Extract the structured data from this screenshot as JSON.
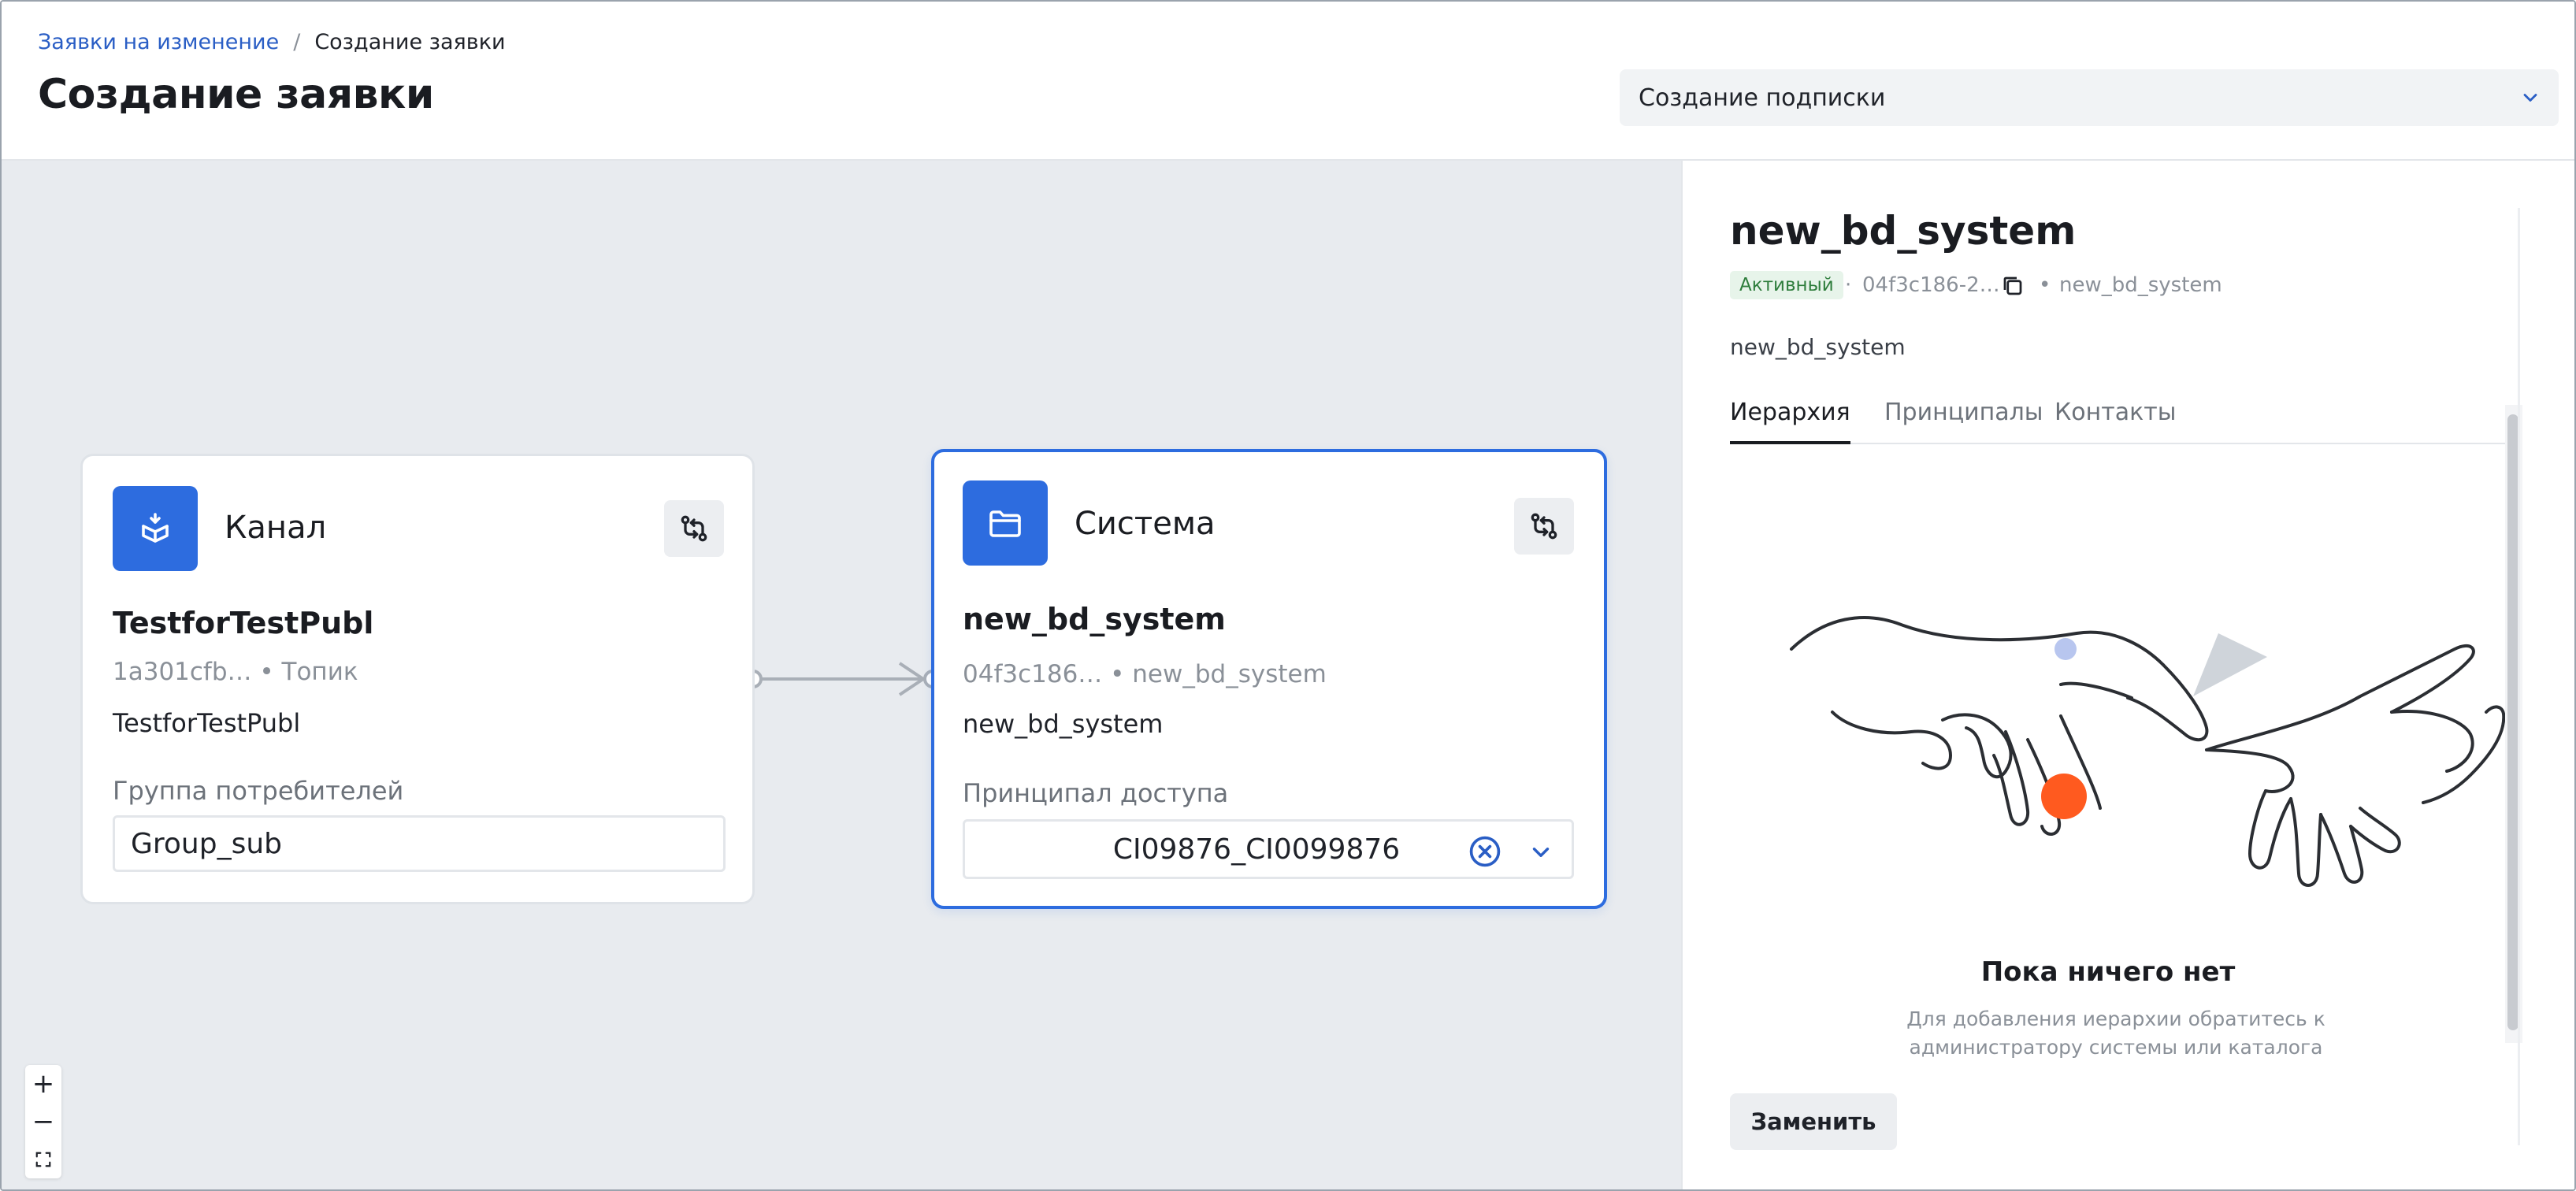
{
  "breadcrumb": {
    "parent": "Заявки на изменение",
    "separator": "/",
    "current": "Создание заявки"
  },
  "page_title": "Создание заявки",
  "request_type_select": {
    "value": "Создание подписки"
  },
  "canvas": {
    "source_node": {
      "type_label": "Канал",
      "name": "TestforTestPubl",
      "meta": "1a301cfb… • Топик",
      "description": "TestforTestPubl",
      "field_label": "Группа потребителей",
      "field_value": "Group_sub"
    },
    "target_node": {
      "type_label": "Система",
      "name": "new_bd_system",
      "meta": "04f3c186… • new_bd_system",
      "description": "new_bd_system",
      "field_label": "Принципал доступа",
      "field_value": "CI09876_CI0099876"
    },
    "zoom_controls": {
      "zoom_in": "+",
      "zoom_out": "−"
    }
  },
  "details_panel": {
    "title": "new_bd_system",
    "status": "Активный",
    "id_short": "04f3c186-2…",
    "system_name": "new_bd_system",
    "description": "new_bd_system",
    "tabs": [
      "Иерархия",
      "Принципалы",
      "Контакты"
    ],
    "active_tab": "Иерархия",
    "empty_title": "Пока ничего нет",
    "empty_text": "Для добавления иерархии обратитесь к администратору системы или каталога",
    "replace_button": "Заменить"
  },
  "colors": {
    "accent": "#2d6cdf",
    "link": "#2a5ec5",
    "canvas_bg": "#e8ebef",
    "status_bg": "#e7f4ea",
    "status_text": "#2e7d3c",
    "illustration_orange": "#ff5a1f"
  }
}
